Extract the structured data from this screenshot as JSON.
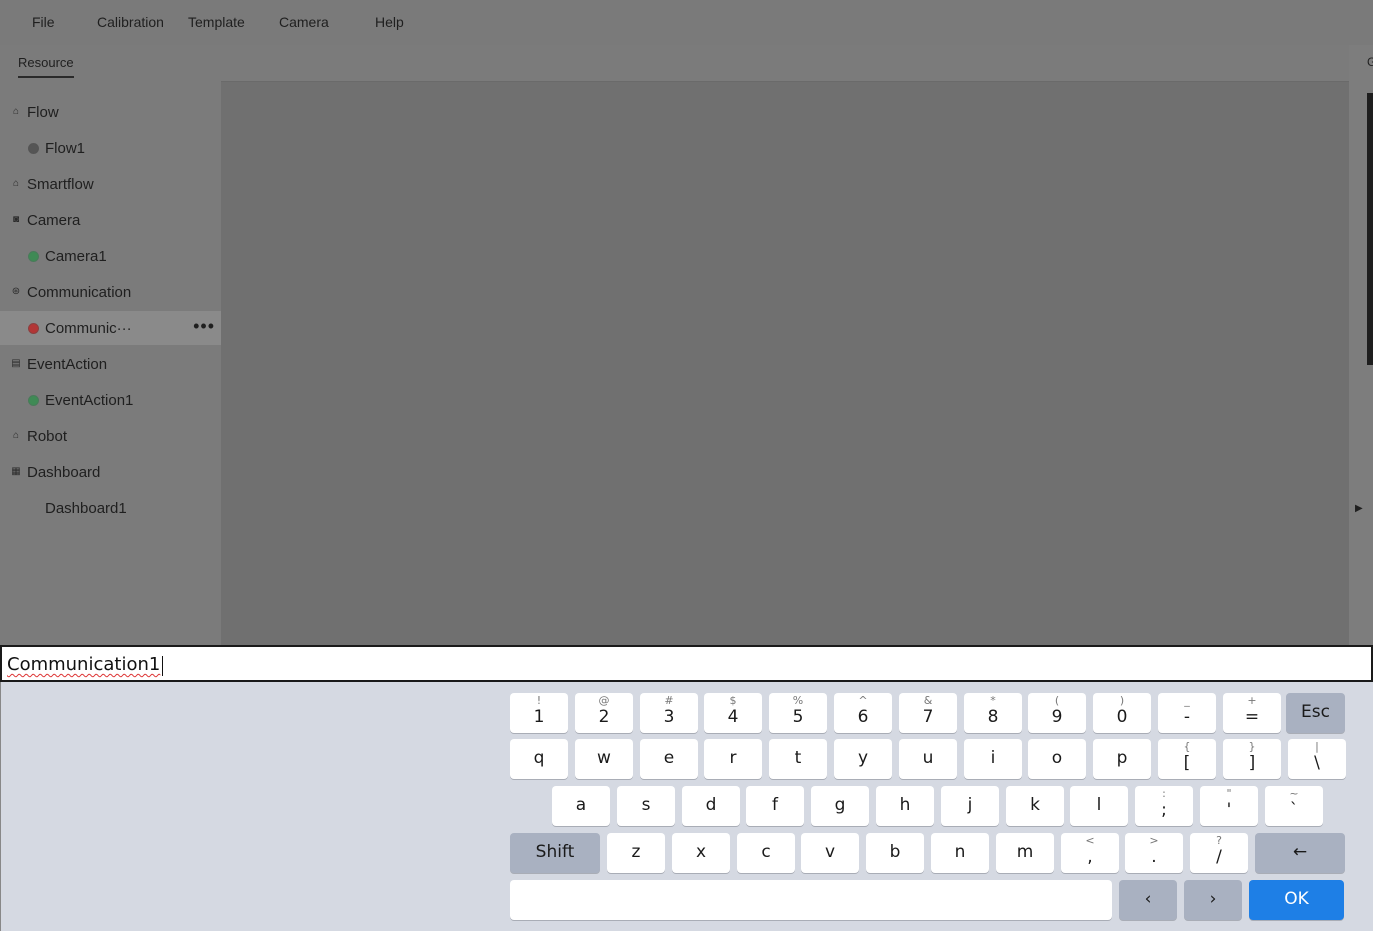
{
  "menubar": {
    "items": [
      "File",
      "Calibration",
      "Template",
      "Camera",
      "Help"
    ]
  },
  "sidebar": {
    "tab": "Resource",
    "tree": [
      {
        "label": "Flow",
        "kind": "group",
        "icon": "flow-icon",
        "glyph": "⌂"
      },
      {
        "label": "Flow1",
        "kind": "child",
        "status": "gray"
      },
      {
        "label": "Smartflow",
        "kind": "group",
        "icon": "smartflow-icon",
        "glyph": "⌂"
      },
      {
        "label": "Camera",
        "kind": "group",
        "icon": "camera-icon",
        "glyph": "◙"
      },
      {
        "label": "Camera1",
        "kind": "child",
        "status": "green"
      },
      {
        "label": "Communication",
        "kind": "group",
        "icon": "communication-icon",
        "glyph": "⊛"
      },
      {
        "label": "Communic···",
        "kind": "child",
        "status": "red",
        "selected": true,
        "more": "•••"
      },
      {
        "label": "EventAction",
        "kind": "group",
        "icon": "event-action-icon",
        "glyph": "▤"
      },
      {
        "label": "EventAction1",
        "kind": "child",
        "status": "green"
      },
      {
        "label": "Robot",
        "kind": "group",
        "icon": "robot-icon",
        "glyph": "⌂"
      },
      {
        "label": "Dashboard",
        "kind": "group",
        "icon": "dashboard-icon",
        "glyph": "▦"
      },
      {
        "label": "Dashboard1",
        "kind": "child",
        "status": "none"
      }
    ]
  },
  "right_panel": {
    "tab": "G"
  },
  "input": {
    "value": "Communication1"
  },
  "keyboard": {
    "rows": [
      [
        {
          "main": "1",
          "shift": "!"
        },
        {
          "main": "2",
          "shift": "@"
        },
        {
          "main": "3",
          "shift": "#"
        },
        {
          "main": "4",
          "shift": "$"
        },
        {
          "main": "5",
          "shift": "%"
        },
        {
          "main": "6",
          "shift": "^"
        },
        {
          "main": "7",
          "shift": "&"
        },
        {
          "main": "8",
          "shift": "*"
        },
        {
          "main": "9",
          "shift": "("
        },
        {
          "main": "0",
          "shift": ")"
        },
        {
          "main": "-",
          "shift": "_"
        },
        {
          "main": "=",
          "shift": "+"
        }
      ],
      [
        {
          "main": "q"
        },
        {
          "main": "w"
        },
        {
          "main": "e"
        },
        {
          "main": "r"
        },
        {
          "main": "t"
        },
        {
          "main": "y"
        },
        {
          "main": "u"
        },
        {
          "main": "i"
        },
        {
          "main": "o"
        },
        {
          "main": "p"
        },
        {
          "main": "[",
          "shift": "{"
        },
        {
          "main": "]",
          "shift": "}"
        },
        {
          "main": "\\",
          "shift": "|"
        }
      ],
      [
        {
          "main": "a"
        },
        {
          "main": "s"
        },
        {
          "main": "d"
        },
        {
          "main": "f"
        },
        {
          "main": "g"
        },
        {
          "main": "h"
        },
        {
          "main": "j"
        },
        {
          "main": "k"
        },
        {
          "main": "l"
        },
        {
          "main": ";",
          "shift": ":"
        },
        {
          "main": "'",
          "shift": "\""
        },
        {
          "main": "`",
          "shift": "~"
        }
      ],
      [
        {
          "main": "z"
        },
        {
          "main": "x"
        },
        {
          "main": "c"
        },
        {
          "main": "v"
        },
        {
          "main": "b"
        },
        {
          "main": "n"
        },
        {
          "main": "m"
        },
        {
          "main": ",",
          "shift": "<"
        },
        {
          "main": ".",
          "shift": ">"
        },
        {
          "main": "/",
          "shift": "?"
        }
      ]
    ],
    "esc_label": "Esc",
    "shift_label": "Shift",
    "backspace_label": "←",
    "left_label": "‹",
    "right_label": "›",
    "ok_label": "OK",
    "colors": {
      "special": "#a9b1c1",
      "ok": "#1e7fe6",
      "background": "#d5d9e2"
    }
  }
}
